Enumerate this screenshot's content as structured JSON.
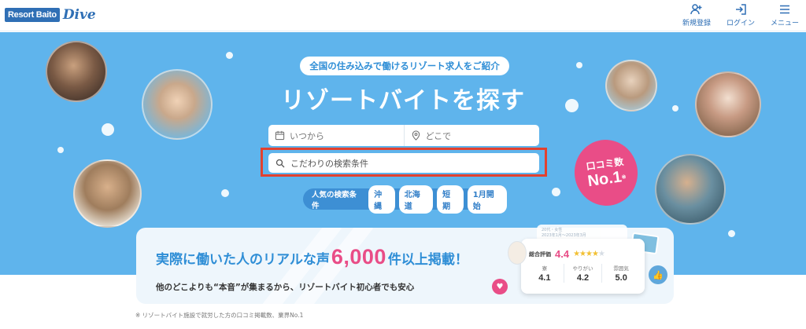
{
  "header": {
    "logo_box": "Resort Baito",
    "logo_script": "Dive",
    "nav": [
      {
        "label": "新規登録",
        "icon": "user-plus-icon"
      },
      {
        "label": "ログイン",
        "icon": "login-icon"
      },
      {
        "label": "メニュー",
        "icon": "menu-icon"
      }
    ]
  },
  "hero": {
    "tagline": "全国の住み込みで働けるリゾート求人をご紹介",
    "title": "リゾートバイトを探す",
    "search": {
      "when_placeholder": "いつから",
      "where_placeholder": "どこで",
      "keyword_placeholder": "こだわりの検索条件"
    },
    "popular": {
      "label": "人気の検索条件",
      "chips": [
        "沖縄",
        "北海道",
        "短期",
        "1月開始"
      ]
    },
    "badge": {
      "line1": "口コミ数",
      "line2": "No.1",
      "mark": "※"
    }
  },
  "panel": {
    "claim_prefix": "実際に働いた人のリアルな声",
    "claim_number": "6,000",
    "claim_suffix": "件以上掲載！",
    "subtext": "他のどこよりも“本音”が集まるから、リゾートバイト初心者でも安心",
    "card": {
      "meta_line1": "20代・女性",
      "meta_line2": "2023年1月〜2023年3月",
      "rating_label": "総合評価",
      "rating_value": "4.4",
      "rating_stars": 4.4,
      "scores": [
        {
          "label": "寮",
          "value": "4.1"
        },
        {
          "label": "やりがい",
          "value": "4.2"
        },
        {
          "label": "雰囲気",
          "value": "5.0"
        }
      ]
    }
  },
  "footnote": "※ リゾートバイト施設で就労した方の口コミ掲載数、業界No.1",
  "colors": {
    "hero_bg": "#5fb4ec",
    "brand_blue": "#2f6fb5",
    "accent_pink": "#e94d87",
    "highlight_red": "#e2412f"
  }
}
